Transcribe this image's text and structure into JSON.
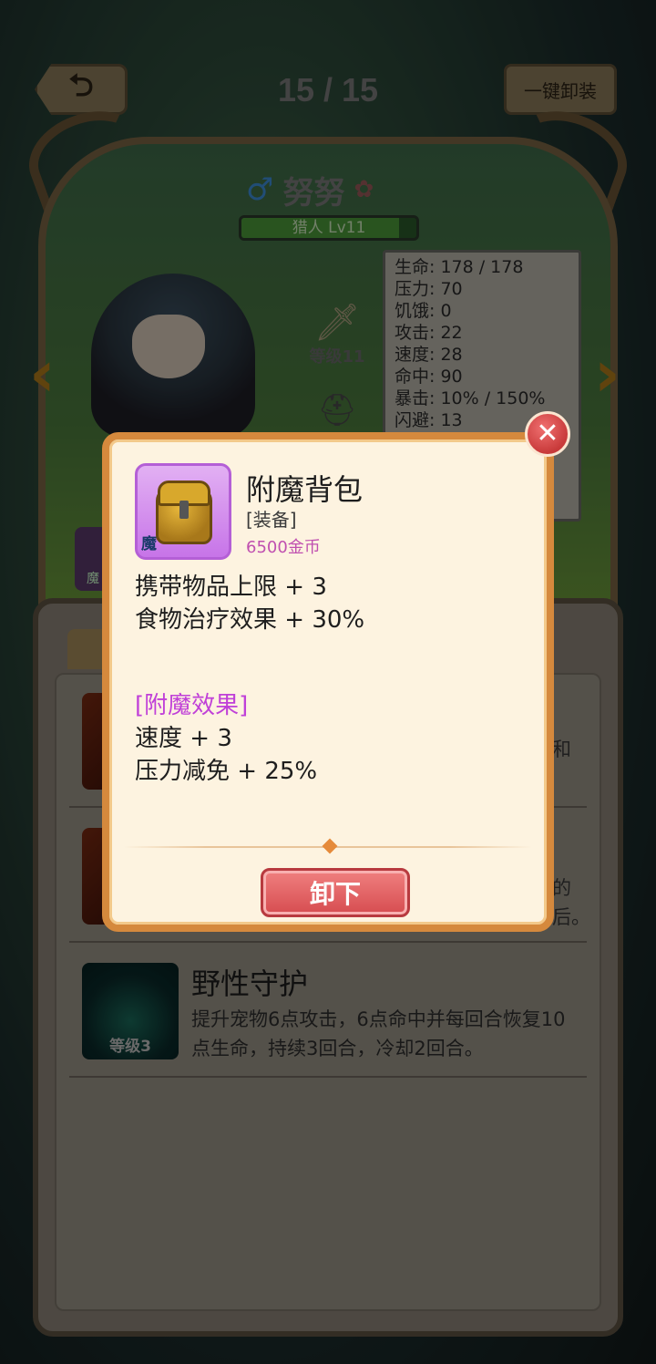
{
  "header": {
    "back_icon": "⮌",
    "page_counter": "15 / 15",
    "unequip_all_label": "一键卸装"
  },
  "character": {
    "gender_icon": "♂",
    "name": "努努",
    "class_level": "猎人 Lv11",
    "xp_progress": 0.9,
    "weapon_level_label": "等级11",
    "stats": [
      "生命: 178 / 178",
      "压力: 70",
      "饥饿: 0",
      "攻击: 22",
      "速度: 28",
      "命中: 90",
      "暴击: 10% / 150%",
      "闪避: 13"
    ],
    "left_slot_tag": "魔"
  },
  "skills": [
    {
      "name": "",
      "desc": "",
      "peek": "和"
    },
    {
      "name": "",
      "desc": "",
      "peek": "的"
    },
    {
      "name": "野性守护",
      "desc": "提升宠物6点攻击，6点命中并每回合恢复10点生命，持续3回合，冷却2回合。",
      "level": "等级3"
    }
  ],
  "skill2_peek_b": "后。",
  "modal": {
    "item_name": "附魔背包",
    "item_type": "[装备]",
    "item_price": "6500金币",
    "enchant_tag": "魔",
    "effects": [
      "携带物品上限 + 3",
      "食物治疗效果 + 30%"
    ],
    "enchant_header": "[附魔效果]",
    "enchant_effects": [
      "速度 + 3",
      "压力减免 + 25%"
    ],
    "unequip_label": "卸下",
    "close_icon": "✕"
  }
}
